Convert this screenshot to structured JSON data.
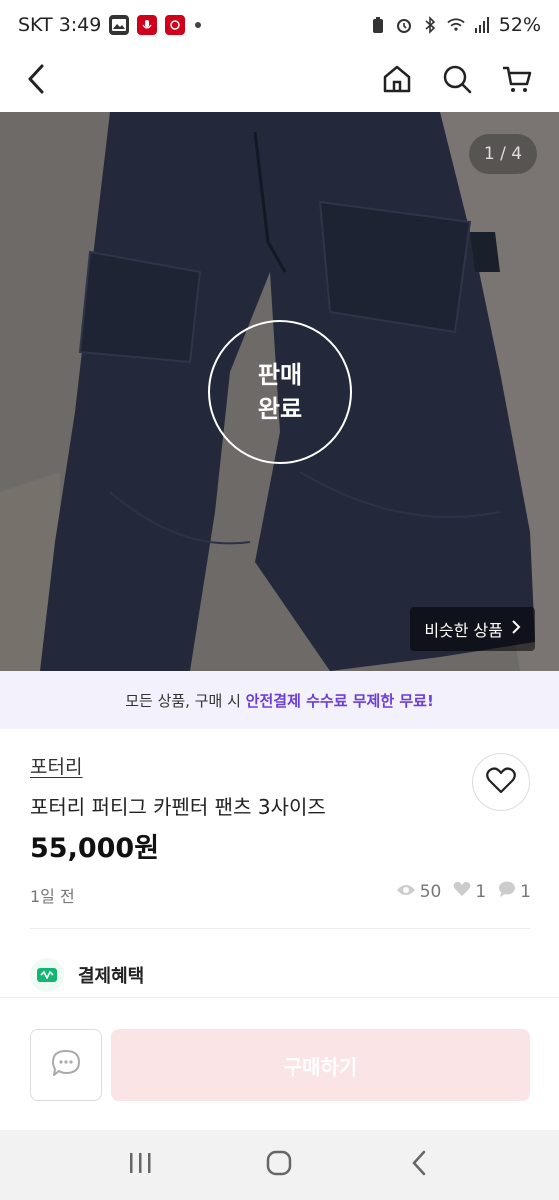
{
  "status_bar": {
    "carrier_time": "SKT 3:49",
    "battery": "52%",
    "icons": [
      "gallery-icon",
      "recorder-icon",
      "app-icon",
      "dot-icon",
      "battery-saver-icon",
      "alarm-icon",
      "bluetooth-icon",
      "wifi-icon",
      "signal-icon"
    ]
  },
  "header": {
    "icons": [
      "back-icon",
      "home-icon",
      "search-icon",
      "cart-icon"
    ]
  },
  "hero": {
    "counter": "1 / 4",
    "sold_line1": "판매",
    "sold_line2": "완료",
    "similar_label": "비슷한 상품"
  },
  "promo": {
    "prefix": "모든 상품, 구매 시 ",
    "highlight": "안전결제 수수료 무제한 무료!"
  },
  "product": {
    "store": "포터리",
    "title": "포터리 퍼티그 카펜터 팬츠 3사이즈",
    "price": "55,000원",
    "posted": "1일 전",
    "views": "50",
    "likes": "1",
    "chats": "1"
  },
  "benefit": {
    "label": "결제혜택"
  },
  "actions": {
    "buy_label": "구매하기"
  },
  "colors": {
    "accent_purple": "#6b3fd6",
    "buy_button_disabled": "#fbe4e6",
    "benefit_green": "#13b573"
  }
}
